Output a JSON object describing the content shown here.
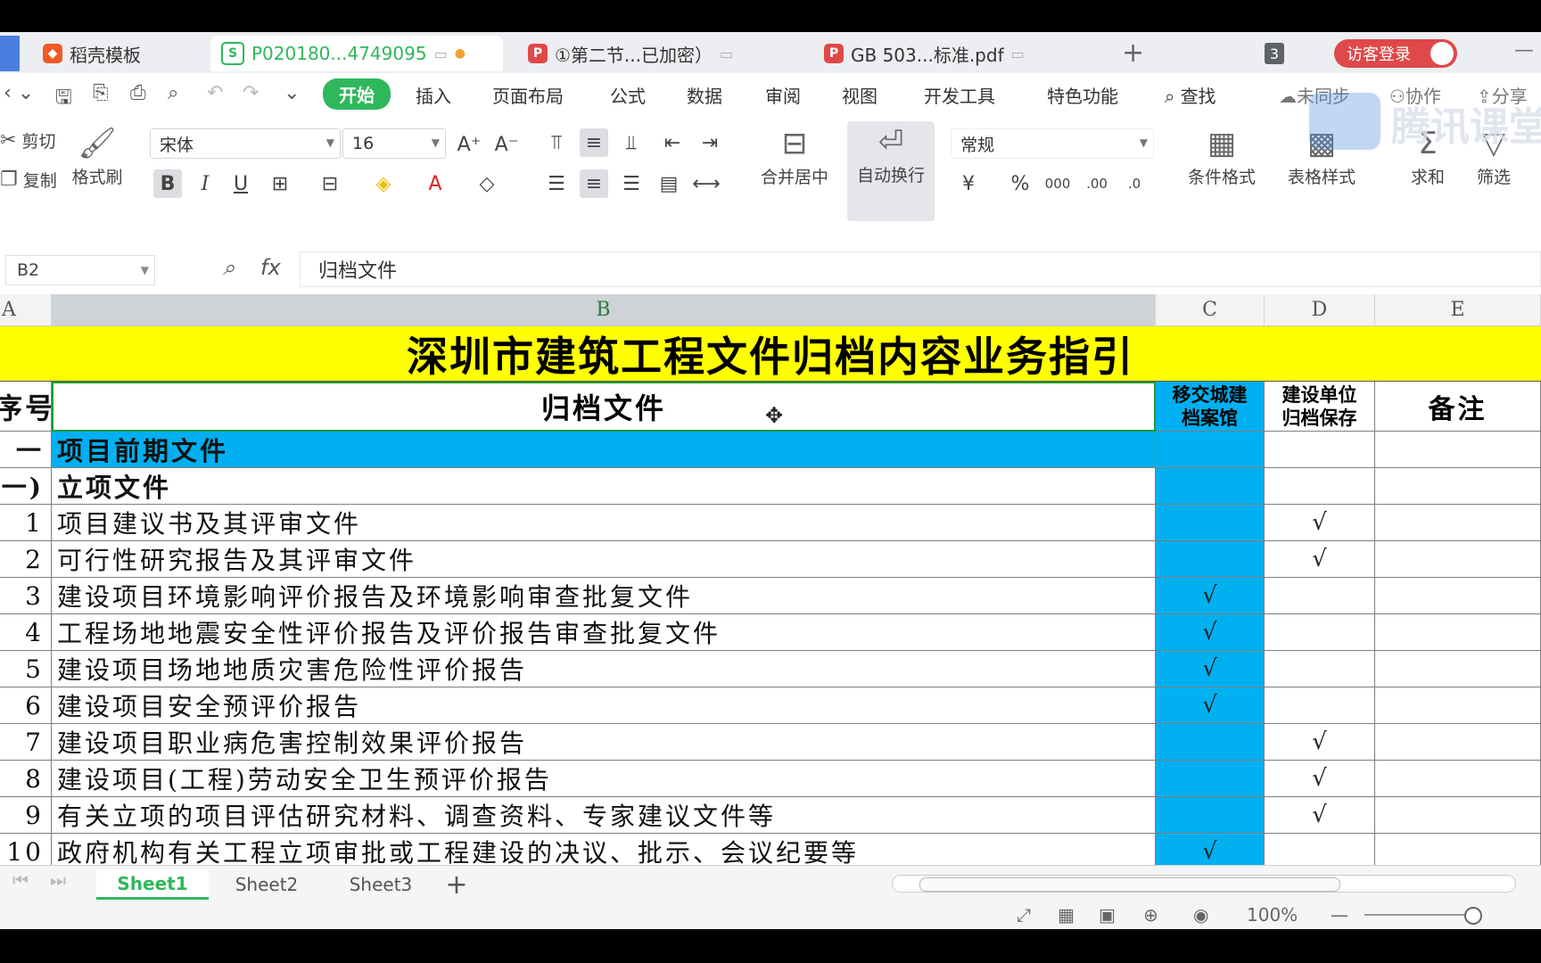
{
  "tabs": [
    {
      "label": "稻壳模板"
    },
    {
      "label": "P020180...4749095"
    },
    {
      "label": "①第二节...已加密）"
    },
    {
      "label": "GB 503...标准.pdf"
    }
  ],
  "tab_count": "3",
  "login_label": "访客登录",
  "menu": [
    "开始",
    "插入",
    "页面布局",
    "公式",
    "数据",
    "审阅",
    "视图",
    "开发工具",
    "特色功能",
    "查找",
    "未同步",
    "协作",
    "分享"
  ],
  "ribbon": {
    "cut": "剪切",
    "copy": "复制",
    "format_painter": "格式刷",
    "font_name": "宋体",
    "font_size": "16",
    "merge_center": "合并居中",
    "wrap_text": "自动换行",
    "number_format": "常规",
    "cond_format": "条件格式",
    "table_style": "表格样式",
    "sum": "求和",
    "filter": "筛选"
  },
  "formula_bar": {
    "name_box": "B2",
    "fx": "fx",
    "value": "归档文件"
  },
  "columns": [
    "A",
    "B",
    "C",
    "D",
    "E"
  ],
  "sheet": {
    "title": "深圳市建筑工程文件归档内容业务指引",
    "header": {
      "seq": "序号",
      "file": "归档文件",
      "c": [
        "移交城建",
        "档案馆"
      ],
      "d": [
        "建设单位",
        "归档保存"
      ],
      "e": "备注"
    },
    "rows": [
      {
        "seq": "一",
        "text": "项目前期文件",
        "c": "",
        "d": ""
      },
      {
        "seq": "(一)",
        "text": "立项文件",
        "c": "",
        "d": ""
      },
      {
        "seq": "1",
        "text": "项目建议书及其评审文件",
        "c": "",
        "d": "√"
      },
      {
        "seq": "2",
        "text": "可行性研究报告及其评审文件",
        "c": "",
        "d": "√"
      },
      {
        "seq": "3",
        "text": "建设项目环境影响评价报告及环境影响审查批复文件",
        "c": "√",
        "d": ""
      },
      {
        "seq": "4",
        "text": "工程场地地震安全性评价报告及评价报告审查批复文件",
        "c": "√",
        "d": ""
      },
      {
        "seq": "5",
        "text": "建设项目场地地质灾害危险性评价报告",
        "c": "√",
        "d": ""
      },
      {
        "seq": "6",
        "text": "建设项目安全预评价报告",
        "c": "√",
        "d": ""
      },
      {
        "seq": "7",
        "text": "建设项目职业病危害控制效果评价报告",
        "c": "",
        "d": "√"
      },
      {
        "seq": "8",
        "text": "建设项目(工程)劳动安全卫生预评价报告",
        "c": "",
        "d": "√"
      },
      {
        "seq": "9",
        "text": "有关立项的项目评估研究材料、调查资料、专家建议文件等",
        "c": "",
        "d": "√"
      },
      {
        "seq": "10",
        "text": "政府机构有关工程立项审批或工程建设的决议、批示、会议纪要等",
        "c": "√",
        "d": ""
      }
    ]
  },
  "sheet_tabs": [
    "Sheet1",
    "Sheet2",
    "Sheet3"
  ],
  "status": {
    "zoom": "100%"
  },
  "colors": {
    "title_fill": "#ffff00",
    "highlight_fill": "#00b0f0",
    "accent": "#2fb75b"
  }
}
